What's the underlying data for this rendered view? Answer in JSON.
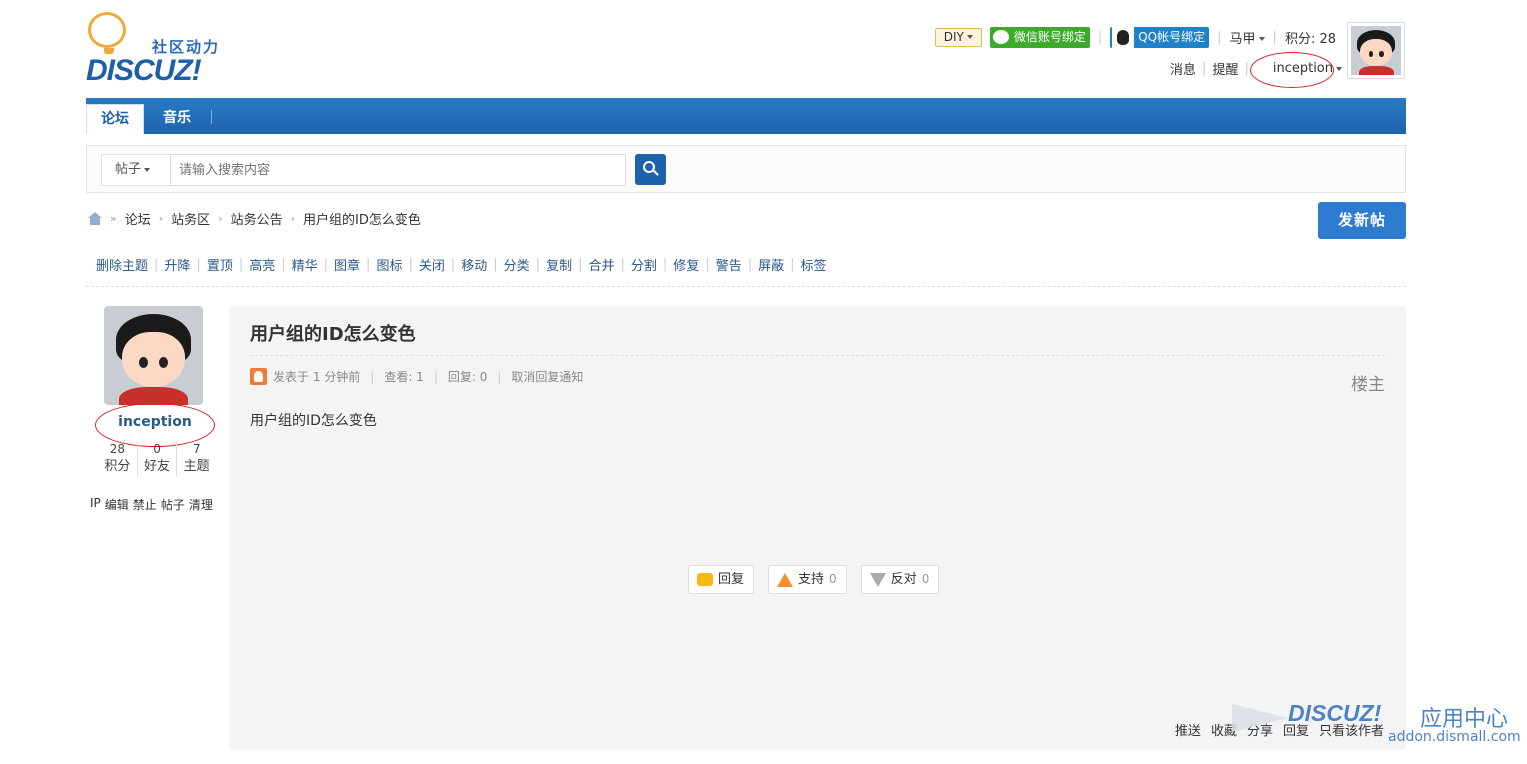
{
  "header": {
    "logo_slogan": "社区动力",
    "logo_wordmark": "DISCUZ!",
    "diy_label": "DIY",
    "wechat_bind_label": "微信账号绑定",
    "qq_bind_label": "QQ帐号绑定",
    "user_menu_label": "马甲",
    "points_label": "积分: 28",
    "messages_label": "消息",
    "notices_label": "提醒",
    "username": "inception"
  },
  "nav": {
    "tabs": [
      {
        "label": "论坛",
        "active": true
      },
      {
        "label": "音乐",
        "active": false
      }
    ]
  },
  "search": {
    "type_label": "帖子",
    "placeholder": "请输入搜索内容"
  },
  "breadcrumb": [
    "论坛",
    "站务区",
    "站务公告",
    "用户组的ID怎么变色"
  ],
  "new_post_label": "发新帖",
  "mod_actions": [
    "删除主题",
    "升降",
    "置顶",
    "高亮",
    "精华",
    "图章",
    "图标",
    "关闭",
    "移动",
    "分类",
    "复制",
    "合并",
    "分割",
    "修复",
    "警告",
    "屏蔽",
    "标签"
  ],
  "author": {
    "name": "inception",
    "stats": [
      {
        "value": "28",
        "label": "积分"
      },
      {
        "value": "0",
        "label": "好友"
      },
      {
        "value": "7",
        "label": "主题"
      }
    ],
    "admin_links": [
      "IP",
      "编辑",
      "禁止",
      "帖子",
      "清理"
    ]
  },
  "post": {
    "title": "用户组的ID怎么变色",
    "posted": "发表于 1 分钟前",
    "views": "查看: 1",
    "replies": "回复: 0",
    "cancel_notify": "取消回复通知",
    "floor": "楼主",
    "body": "用户组的ID怎么变色",
    "actions": [
      {
        "label": "回复",
        "count": ""
      },
      {
        "label": "支持",
        "count": "0"
      },
      {
        "label": "反对",
        "count": "0"
      }
    ],
    "footer_links": [
      "推送",
      "收藏",
      "分享",
      "回复",
      "只看该作者"
    ]
  },
  "watermark": {
    "brand": "DISCUZ!",
    "title": "应用中心",
    "url": "addon.dismall.com"
  },
  "colors": {
    "nav_blue": "#1e62aa",
    "accent_blue": "#2c7bd1",
    "highlight_red": "#e02020"
  }
}
